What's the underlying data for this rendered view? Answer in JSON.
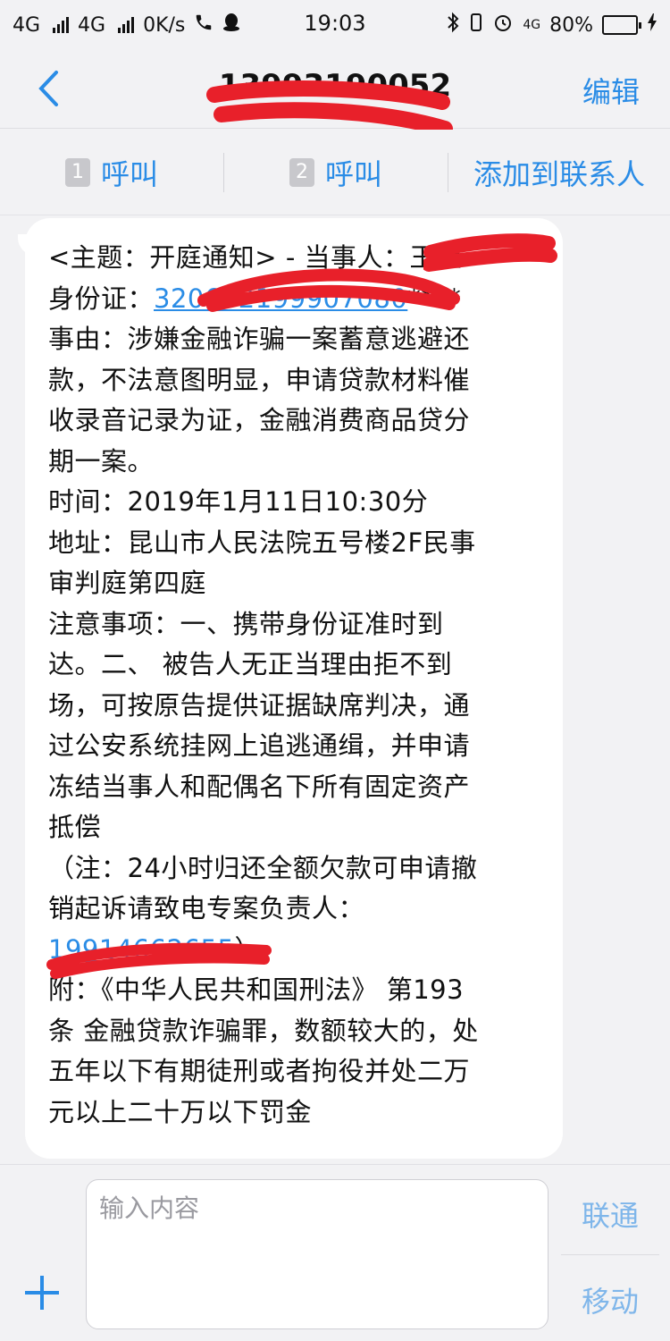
{
  "status_bar": {
    "network1": "4G",
    "network2": "4G",
    "speed": "0K/s",
    "time": "19:03",
    "network3": "4G",
    "battery": "80%",
    "battery_level": 0.8
  },
  "nav": {
    "title": "13993190052",
    "edit_label": "编辑"
  },
  "actions": {
    "call1_sim": "1",
    "call1_label": "呼叫",
    "call2_sim": "2",
    "call2_label": "呼叫",
    "add_contact_label": "添加到联系人"
  },
  "message": {
    "lines": [
      "<主题：开庭通知> - 当事人：",
      "身份证：",
      "事由：涉嫌金融诈骗一案蓄意逃避还",
      "款，不法意图明显，申请贷款材料催",
      "收录音记录为证，金融消费商品贷分",
      "期一案。",
      "时间：2019年1月11日10:30分",
      "地址：昆山市人民法院五号楼2F民事",
      "审判庭第四庭",
      "注意事项：一、携带身份证准时到",
      "达。二、 被告人无正当理由拒不到",
      "场，可按原告提供证据缺席判决，通",
      "过公安系统挂网上追逃通缉，并申请",
      "冻结当事人和配偶名下所有固定资产",
      "抵偿",
      "（注：24小时归还全额欠款可申请撤",
      "销起诉请致电专案负责人：",
      "",
      "附：《中华人民共和国刑法》 第193",
      "条 金融贷款诈骗罪，数额较大的，处",
      "五年以下有期徒刑或者拘役并处二万",
      "元以上二十万以下罚金"
    ],
    "party_name": "王超",
    "id_number": "320602199907080",
    "id_mask": "****",
    "phone": "19914662655",
    "phone_suffix": "）"
  },
  "input": {
    "placeholder": "输入内容",
    "send_unicom": "联通",
    "send_mobile": "移动"
  },
  "colors": {
    "accent": "#2a8ce6",
    "redaction": "#e8202a"
  }
}
